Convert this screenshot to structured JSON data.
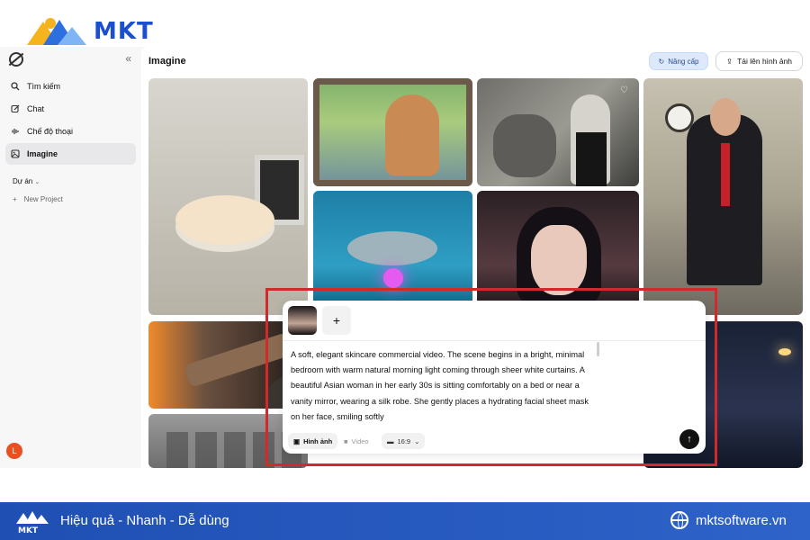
{
  "brand": {
    "name": "MKT"
  },
  "sidebar": {
    "collapse_icon": "double-chevron-left-icon",
    "items": [
      {
        "label": "Tìm kiếm",
        "icon": "search-icon"
      },
      {
        "label": "Chat",
        "icon": "edit-icon"
      },
      {
        "label": "Chế độ thoại",
        "icon": "voice-icon"
      },
      {
        "label": "Imagine",
        "icon": "image-icon",
        "active": true
      }
    ],
    "projects_label": "Dự án",
    "new_project_label": "New Project",
    "avatar_letter": "L"
  },
  "main": {
    "title": "Imagine",
    "upgrade_label": "Nâng cấp",
    "upload_label": "Tải lên hình ảnh"
  },
  "composer": {
    "prompt": "A soft, elegant skincare commercial video. The scene begins in a bright, minimal bedroom with warm natural morning light coming through sheer white curtains. A beautiful Asian woman in her early 30s is sitting comfortably on a bed or near a vanity mirror, wearing a silk robe. She gently places a hydrating facial sheet mask on her face, smiling softly",
    "mode_image": "Hình ảnh",
    "mode_video": "Video",
    "aspect_ratio": "16:9",
    "add_label": "+"
  },
  "footer": {
    "slogan": "Hiệu quả - Nhanh - Dễ dùng",
    "url": "mktsoftware.vn"
  },
  "colors": {
    "brand_blue": "#1a4fd0",
    "highlight_red": "#d22a2a",
    "footer_blue": "#2e63c9",
    "upgrade_bg": "#dde8fb"
  }
}
